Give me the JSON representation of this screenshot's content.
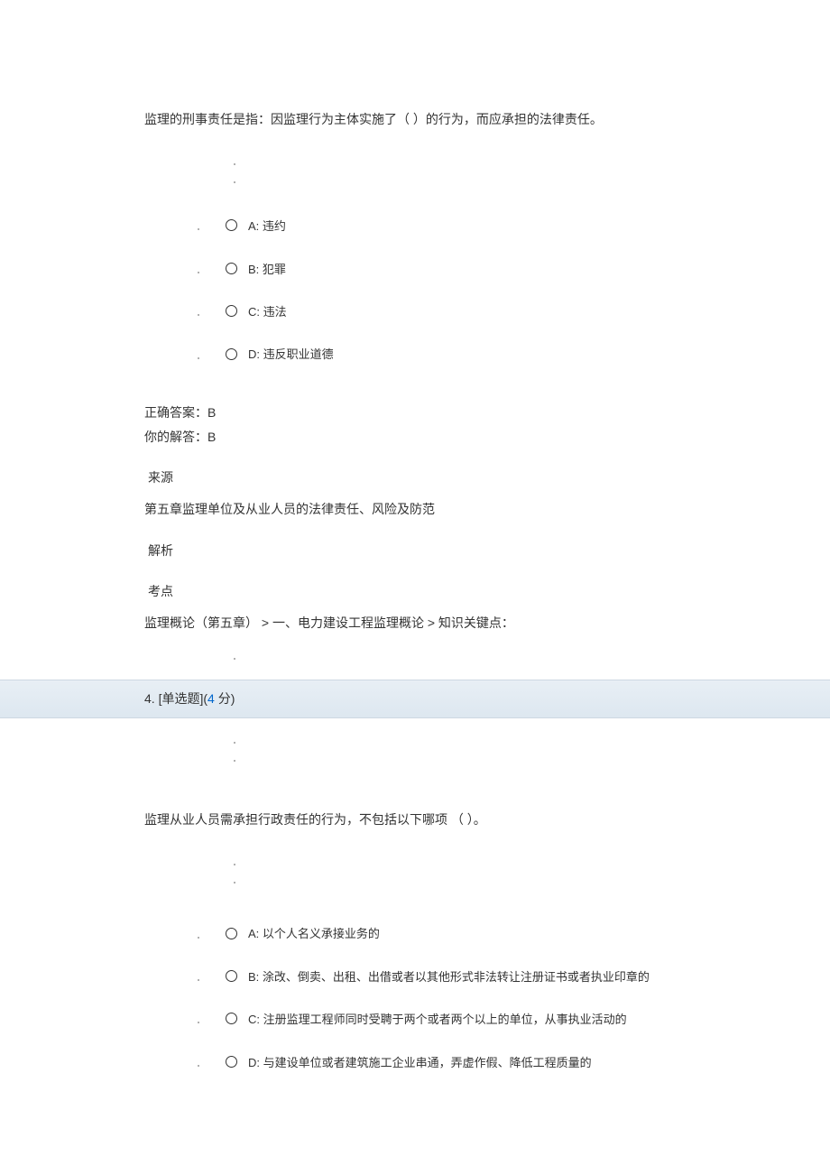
{
  "question3": {
    "text": "监理的刑事责任是指：因监理行为主体实施了（ ）的行为，而应承担的法律责任。",
    "options": {
      "a": "A:  违约",
      "b": "B:  犯罪",
      "c": "C:  违法",
      "d": "D:  违反职业道德"
    },
    "correctLabel": "正确答案：B",
    "yourAnswerLabel": "你的解答：B",
    "sourceLabel": "来源",
    "sourceText": "第五章监理单位及从业人员的法律责任、风险及防范",
    "analysisLabel": "解析",
    "pointLabel": "考点",
    "breadcrumb": "监理概论（第五章）  >  一、电力建设工程监理概论  >  知识关键点："
  },
  "question4": {
    "headerNum": "4. [单选题]",
    "headerScoreOpen": "(",
    "headerScoreNum": "4",
    "headerScoreUnit": " 分",
    "headerScoreClose": ")",
    "text": "监理从业人员需承担行政责任的行为，不包括以下哪项 （ ）。",
    "options": {
      "a": "A:  以个人名义承接业务的",
      "b": "B:  涂改、倒卖、出租、出借或者以其他形式非法转让注册证书或者执业印章的",
      "c": "C:  注册监理工程师同时受聘于两个或者两个以上的单位，从事执业活动的",
      "d": "D:  与建设单位或者建筑施工企业串通，弄虚作假、降低工程质量的"
    }
  }
}
